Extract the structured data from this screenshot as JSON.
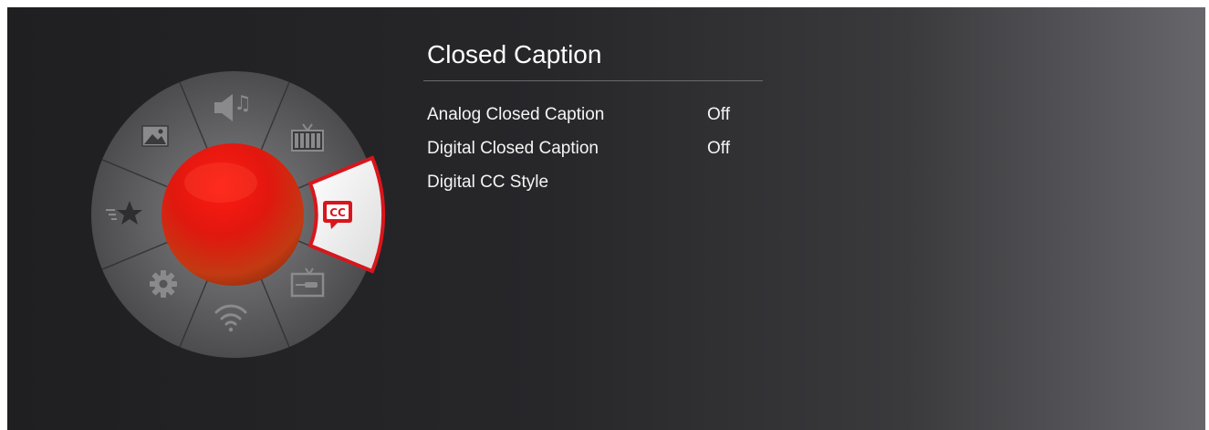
{
  "panel": {
    "title": "Closed Caption",
    "items": [
      {
        "label": "Analog Closed Caption",
        "value": "Off"
      },
      {
        "label": "Digital Closed Caption",
        "value": "Off"
      },
      {
        "label": "Digital CC Style",
        "value": ""
      }
    ]
  },
  "wheel": {
    "selected_segment": "closed-caption",
    "segments": [
      {
        "icon": "picture-icon"
      },
      {
        "icon": "sound-icon"
      },
      {
        "icon": "tv-channel-icon"
      },
      {
        "icon": "closed-caption-icon",
        "icon_text": "CC"
      },
      {
        "icon": "input-source-icon"
      },
      {
        "icon": "network-icon"
      },
      {
        "icon": "settings-icon"
      },
      {
        "icon": "favorites-icon"
      }
    ]
  },
  "colors": {
    "accent": "#d8161c",
    "background": "#232326",
    "wheel": "#5a5a5c",
    "text": "#f4f4f4"
  }
}
